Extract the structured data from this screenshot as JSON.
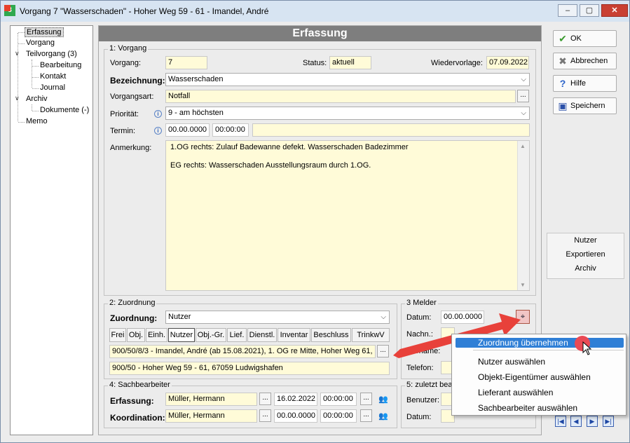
{
  "window": {
    "title": "Vorgang 7 \"Wasserschaden\" - Hoher Weg 59 - 61 - Imandel, André",
    "app_icon_text": "3"
  },
  "tree": {
    "items": [
      {
        "label": "Erfassung"
      },
      {
        "label": "Vorgang"
      },
      {
        "label": "Teilvorgang (3)"
      },
      {
        "label": "Bearbeitung"
      },
      {
        "label": "Kontakt"
      },
      {
        "label": "Journal"
      },
      {
        "label": "Archiv"
      },
      {
        "label": "Dokumente (-)"
      },
      {
        "label": "Memo"
      }
    ]
  },
  "header": {
    "title": "Erfassung"
  },
  "vorgang": {
    "group_label": "1: Vorgang",
    "vorgang_label": "Vorgang:",
    "vorgang_value": "7",
    "status_label": "Status:",
    "status_value": "aktuell",
    "wiedervorlage_label": "Wiedervorlage:",
    "wiedervorlage_value": "07.09.2022",
    "bezeichnung_label": "Bezeichnung:",
    "bezeichnung_value": "Wasserschaden",
    "vorgangsart_label": "Vorgangsart:",
    "vorgangsart_value": "Notfall",
    "prioritaet_label": "Priorität:",
    "prioritaet_value": "9 - am höchsten",
    "termin_label": "Termin:",
    "termin_date": "00.00.0000",
    "termin_time": "00:00:00",
    "anmerkung_label": "Anmerkung:",
    "anmerkung_line1": "1.OG rechts: Zulauf Badewanne defekt. Wasserschaden Badezimmer",
    "anmerkung_line2": "EG rechts: Wasserschaden Ausstellungsraum durch 1.OG."
  },
  "zuordnung": {
    "group_label": "2: Zuordnung",
    "label": "Zuordnung:",
    "value": "Nutzer",
    "tabs": [
      {
        "label": "Frei"
      },
      {
        "label": "Obj."
      },
      {
        "label": "Einh."
      },
      {
        "label": "Nutzer"
      },
      {
        "label": "Obj.-Gr."
      },
      {
        "label": "Lief."
      },
      {
        "label": "Dienstl."
      },
      {
        "label": "Inventar"
      },
      {
        "label": "Beschluss"
      },
      {
        "label": "TrinkwV"
      }
    ],
    "line1": "900/50/8/3 - Imandel, André  (ab 15.08.2021), 1. OG re Mitte, Hoher Weg 61, 6",
    "line2": "900/50 - Hoher Weg 59 - 61, 67059 Ludwigshafen"
  },
  "melder": {
    "group_label": "3 Melder",
    "datum_label": "Datum:",
    "datum_value": "00.00.0000",
    "nachname_label": "Nachn.:",
    "vorname_label": "orname:",
    "telefon_label": "Telefon:"
  },
  "sachbearbeiter": {
    "group_label": "4: Sachbearbeiter",
    "erfassung_label": "Erfassung:",
    "erfassung_name": "Müller, Hermann",
    "erfassung_date": "16.02.2022",
    "erfassung_time": "00:00:00",
    "koordination_label": "Koordination:",
    "koordination_name": "Müller, Hermann",
    "koordination_date": "00.00.0000",
    "koordination_time": "00:00:00"
  },
  "zuletzt": {
    "group_label": "5: zuletzt bea",
    "benutzer_label": "Benutzer:",
    "datum_label": "Datum:"
  },
  "side": {
    "ok": "OK",
    "abbrechen": "Abbrechen",
    "hilfe": "Hilfe",
    "speichern": "Speichern",
    "box": [
      "Nutzer",
      "Exportieren",
      "Archiv"
    ]
  },
  "context_menu": {
    "items": [
      {
        "label": "Zuordnung übernehmen"
      },
      {
        "label": "Nutzer auswählen"
      },
      {
        "label": "Objekt-Eigentümer auswählen"
      },
      {
        "label": "Lieferant auswählen"
      },
      {
        "label": "Sachbearbeiter auswählen"
      }
    ]
  },
  "colors": {
    "header_bg": "#7e7e7e",
    "field_yellow": "#fffbd8",
    "menu_highlight": "#2f7fd6",
    "arrow_red": "#e8413a"
  },
  "icons": [
    "app-icon",
    "minimize-icon",
    "maximize-icon",
    "close-icon",
    "info-icon",
    "chevron-down-icon",
    "binoculars-icon",
    "people-icon",
    "checkmark-icon",
    "cross-icon",
    "help-icon",
    "save-icon",
    "first-icon",
    "prev-icon",
    "next-icon",
    "last-icon",
    "red-arrow-annotation"
  ]
}
